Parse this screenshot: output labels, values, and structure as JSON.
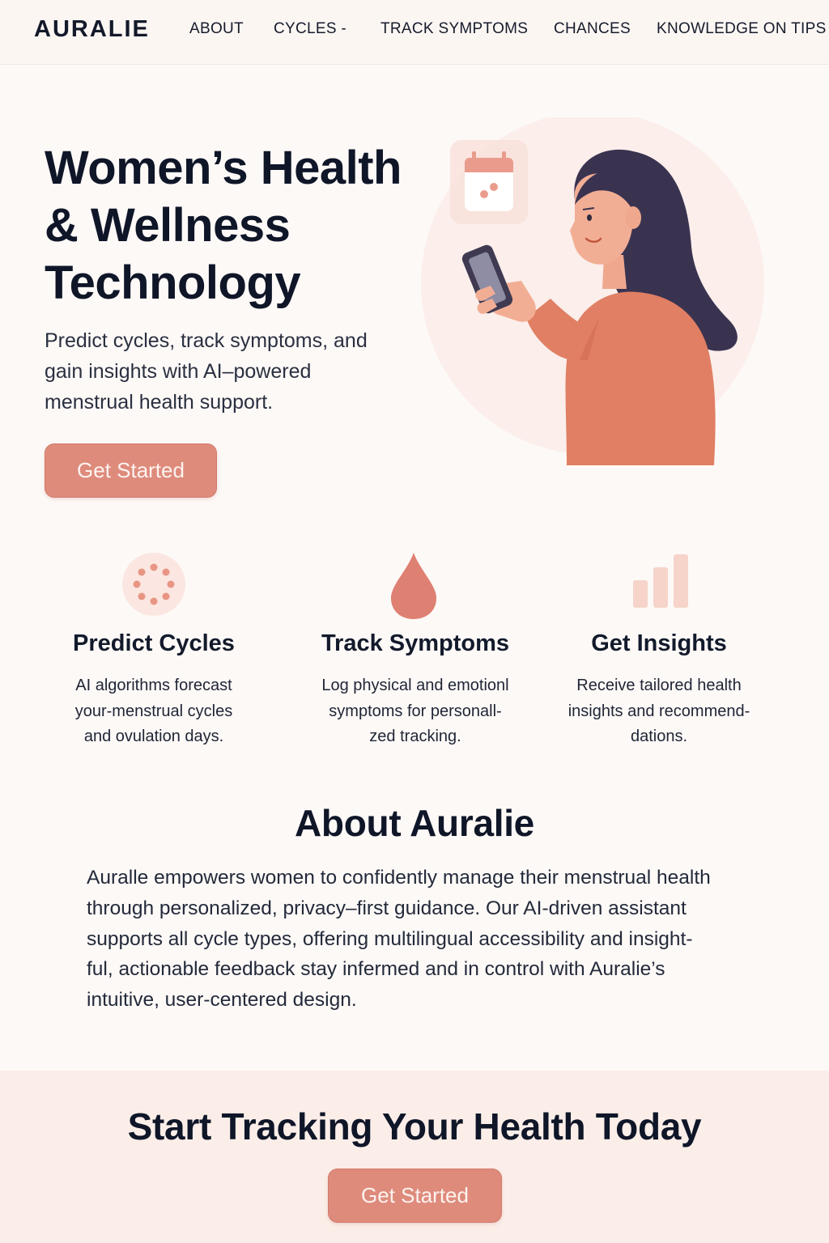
{
  "nav": {
    "logo": "AURALIE",
    "items": [
      {
        "label": "ABOUT"
      },
      {
        "label": "CYCLES -"
      },
      {
        "label": "TRACK SYMPTOMS"
      },
      {
        "label": "CHANCES"
      },
      {
        "label": "KNOWLEDGE ON TIPS"
      }
    ]
  },
  "hero": {
    "title_lines": [
      "Women’s Health",
      "& Wellness",
      "Technology"
    ],
    "subtitle_lines": [
      "Predict cycles, track symptoms, and",
      "gain insights with AI–powered",
      "menstrual health support."
    ],
    "cta_label": "Get Started"
  },
  "features": [
    {
      "icon": "cycle-dots-icon",
      "title": "Predict Cycles",
      "desc_lines": [
        "AI algorithms forecast",
        "your-menstrual cycles",
        "and ovulation days."
      ]
    },
    {
      "icon": "drop-icon",
      "title": "Track Symptoms",
      "desc_lines": [
        "Log physical and emotionl",
        "symptoms for personall-",
        "zed tracking."
      ]
    },
    {
      "icon": "bar-chart-icon",
      "title": "Get Insights",
      "desc_lines": [
        "Receive tailored health",
        "insights and recommend-",
        "dations."
      ]
    }
  ],
  "about": {
    "title": "About Auralie",
    "lines": [
      "Auralle empowers women to confidently manage their menstrual health",
      "through personalized, privacy–first guidance. Our AI-driven assistant",
      "supports all cycle types, offering multilingual accessibility and insight-",
      "ful, actionable feedback stay infermed and in control with Auralie’s",
      "intuitive, user-centered design."
    ]
  },
  "cta": {
    "title": "Start Tracking Your Health Today",
    "button_label": "Get Started"
  },
  "colors": {
    "accent": "#de8b7c",
    "background": "#fdf9f7",
    "text": "#0f1628",
    "hair": "#3a3350",
    "sweater": "#e07f63"
  }
}
